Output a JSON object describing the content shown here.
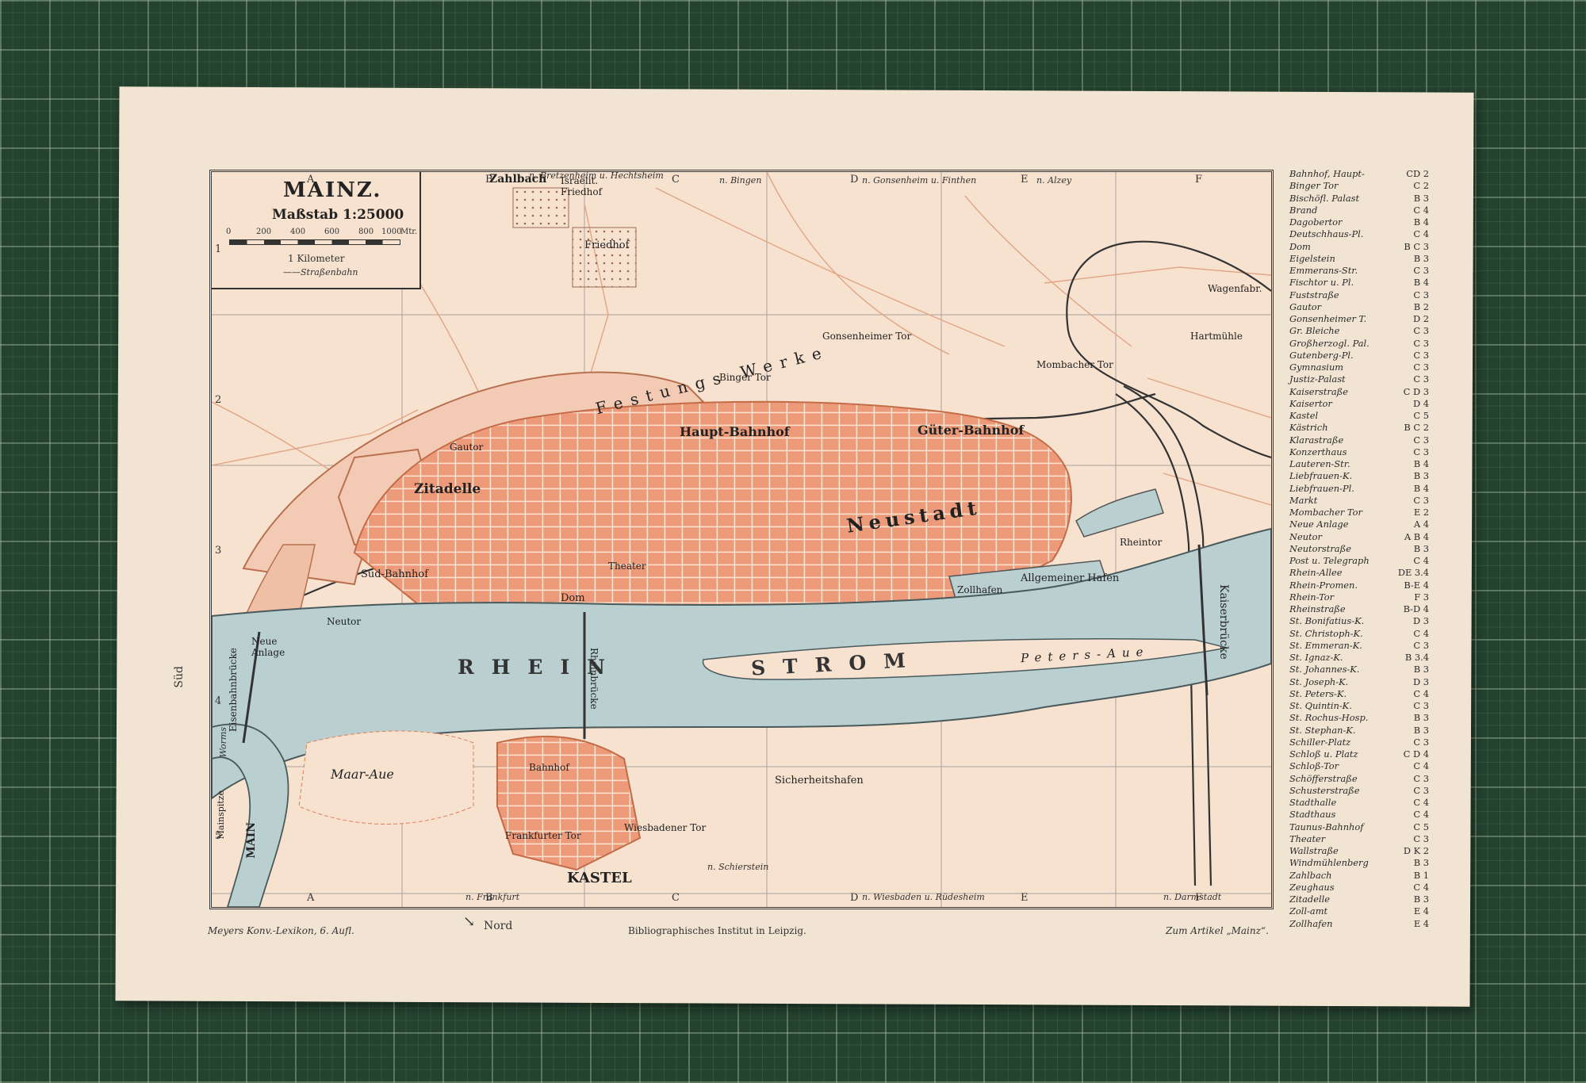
{
  "map": {
    "title": "MAINZ.",
    "scale": "Maßstab 1:25000",
    "scale_ticks": [
      "0",
      "200",
      "400",
      "600",
      "800",
      "1000",
      "Mtr."
    ],
    "kilometer": "1 Kilometer",
    "tram": "Straßenbahn"
  },
  "grid": {
    "columns": [
      "A",
      "B",
      "C",
      "D",
      "E",
      "F"
    ],
    "rows": [
      "1",
      "2",
      "3",
      "4",
      "5"
    ]
  },
  "districts": [
    {
      "label": "Neustadt"
    },
    {
      "label": "KASTEL"
    },
    {
      "label": "Zitadelle"
    },
    {
      "label": "Haupt-Bahnhof"
    },
    {
      "label": "Güter-Bahnhof"
    },
    {
      "label": "Süd-Bahnhof"
    },
    {
      "label": "Neue Anlage"
    },
    {
      "label": "Maar-Aue"
    },
    {
      "label": "Peters-Aue"
    },
    {
      "label": "Zahlbach"
    },
    {
      "label": "Friedhof"
    },
    {
      "label": "Israelit. Friedhof"
    },
    {
      "label": "Sicherheitshafen"
    },
    {
      "label": "Zollhafen"
    },
    {
      "label": "Allgemeiner Hafen"
    },
    {
      "label": "Wagenfabr."
    },
    {
      "label": "Hartmühle"
    },
    {
      "label": "Mombacher Tor"
    },
    {
      "label": "Gonsenheimer Tor"
    },
    {
      "label": "Binger Tor"
    },
    {
      "label": "Gautor"
    },
    {
      "label": "Neutor"
    },
    {
      "label": "Rheintor"
    },
    {
      "label": "Festungs Werke"
    },
    {
      "label": "Theater"
    },
    {
      "label": "Dom"
    },
    {
      "label": "Bahnhof"
    },
    {
      "label": "Frankfurter Tor"
    },
    {
      "label": "Wiesbadener Tor"
    },
    {
      "label": "Kaiserbrücke"
    },
    {
      "label": "Rheinbrücke"
    },
    {
      "label": "Eisenbahnbrücke"
    },
    {
      "label": "MAIN"
    },
    {
      "label": "Mainspitze"
    }
  ],
  "river": {
    "rhein": "RHEIN",
    "strom": "STROM"
  },
  "roads": {
    "n_bretzenheim": "n. Bretzenheim u. Hechtsheim",
    "n_bingen": "n. Bingen",
    "n_gonsenheim": "n. Gonsenheim u. Finthen",
    "n_alzey": "n. Alzey",
    "n_frankfurt": "n. Frankfurt",
    "n_wiesbaden": "n. Wiesbaden u. Rüdesheim",
    "n_darmstadt": "n. Darmstadt",
    "n_schierstein": "n. Schierstein",
    "sud": "Süd",
    "nord": "Nord",
    "worms": "Worms"
  },
  "footer": {
    "left": "Meyers Konv.-Lexikon, 6. Aufl.",
    "center": "Bibliographisches Institut in Leipzig.",
    "right": "Zum Artikel „Mainz“."
  },
  "index": [
    {
      "name": "Bahnhof, Haupt-",
      "ref": "CD 2"
    },
    {
      "name": "Binger Tor",
      "ref": "C 2"
    },
    {
      "name": "Bischöfl. Palast",
      "ref": "B 3"
    },
    {
      "name": "Brand",
      "ref": "C 4"
    },
    {
      "name": "Dagobertor",
      "ref": "B 4"
    },
    {
      "name": "Deutschhaus-Pl.",
      "ref": "C 4"
    },
    {
      "name": "Dom",
      "ref": "B C 3"
    },
    {
      "name": "Eigelstein",
      "ref": "B 3"
    },
    {
      "name": "Emmerans-Str.",
      "ref": "C 3"
    },
    {
      "name": "Fischtor u. Pl.",
      "ref": "B 4"
    },
    {
      "name": "Fuststraße",
      "ref": "C 3"
    },
    {
      "name": "Gautor",
      "ref": "B 2"
    },
    {
      "name": "Gonsenheimer T.",
      "ref": "D 2"
    },
    {
      "name": "Gr. Bleiche",
      "ref": "C 3"
    },
    {
      "name": "Großherzogl. Pal.",
      "ref": "C 3"
    },
    {
      "name": "Gutenberg-Pl.",
      "ref": "C 3"
    },
    {
      "name": "Gymnasium",
      "ref": "C 3"
    },
    {
      "name": "Justiz-Palast",
      "ref": "C 3"
    },
    {
      "name": "Kaiserstraße",
      "ref": "C D 3"
    },
    {
      "name": "Kaisertor",
      "ref": "D 4"
    },
    {
      "name": "Kastel",
      "ref": "C 5"
    },
    {
      "name": "Kästrich",
      "ref": "B C 2"
    },
    {
      "name": "Klarastraße",
      "ref": "C 3"
    },
    {
      "name": "Konzerthaus",
      "ref": "C 3"
    },
    {
      "name": "Lauteren-Str.",
      "ref": "B 4"
    },
    {
      "name": "Liebfrauen-K.",
      "ref": "B 3"
    },
    {
      "name": "Liebfrauen-Pl.",
      "ref": "B 4"
    },
    {
      "name": "Markt",
      "ref": "C 3"
    },
    {
      "name": "Mombacher Tor",
      "ref": "E 2"
    },
    {
      "name": "Neue Anlage",
      "ref": "A 4"
    },
    {
      "name": "Neutor",
      "ref": "A B 4"
    },
    {
      "name": "Neutorstraße",
      "ref": "B 3"
    },
    {
      "name": "Post u. Telegraph",
      "ref": "C 4"
    },
    {
      "name": "Rhein-Allee",
      "ref": "DE 3.4"
    },
    {
      "name": "Rhein-Promen.",
      "ref": "B-E 4"
    },
    {
      "name": "Rhein-Tor",
      "ref": "F 3"
    },
    {
      "name": "Rheinstraße",
      "ref": "B-D 4"
    },
    {
      "name": "St. Bonifatius-K.",
      "ref": "D 3"
    },
    {
      "name": "St. Christoph-K.",
      "ref": "C 4"
    },
    {
      "name": "St. Emmeran-K.",
      "ref": "C 3"
    },
    {
      "name": "St. Ignaz-K.",
      "ref": "B 3.4"
    },
    {
      "name": "St. Johannes-K.",
      "ref": "B 3"
    },
    {
      "name": "St. Joseph-K.",
      "ref": "D 3"
    },
    {
      "name": "St. Peters-K.",
      "ref": "C 4"
    },
    {
      "name": "St. Quintin-K.",
      "ref": "C 3"
    },
    {
      "name": "St. Rochus-Hosp.",
      "ref": "B 3"
    },
    {
      "name": "St. Stephan-K.",
      "ref": "B 3"
    },
    {
      "name": "Schiller-Platz",
      "ref": "C 3"
    },
    {
      "name": "Schloß u. Platz",
      "ref": "C D 4"
    },
    {
      "name": "Schloß-Tor",
      "ref": "C 4"
    },
    {
      "name": "Schöfferstraße",
      "ref": "C 3"
    },
    {
      "name": "Schusterstraße",
      "ref": "C 3"
    },
    {
      "name": "Stadthalle",
      "ref": "C 4"
    },
    {
      "name": "Stadthaus",
      "ref": "C 4"
    },
    {
      "name": "Taunus-Bahnhof",
      "ref": "C 5"
    },
    {
      "name": "Theater",
      "ref": "C 3"
    },
    {
      "name": "Wallstraße",
      "ref": "D K 2"
    },
    {
      "name": "Windmühlenberg",
      "ref": "B 3"
    },
    {
      "name": "Zahlbach",
      "ref": "B 1"
    },
    {
      "name": "Zeughaus",
      "ref": "C 4"
    },
    {
      "name": "Zitadelle",
      "ref": "B 3"
    },
    {
      "name": "Zoll-amt",
      "ref": "E 4"
    },
    {
      "name": "Zollhafen",
      "ref": "E 4"
    }
  ],
  "colors": {
    "river": "#b9cfd0",
    "city": "#ec9e7e",
    "roads": "#d9825d",
    "paper": "#f1e4d2",
    "mat": "#24432f"
  }
}
